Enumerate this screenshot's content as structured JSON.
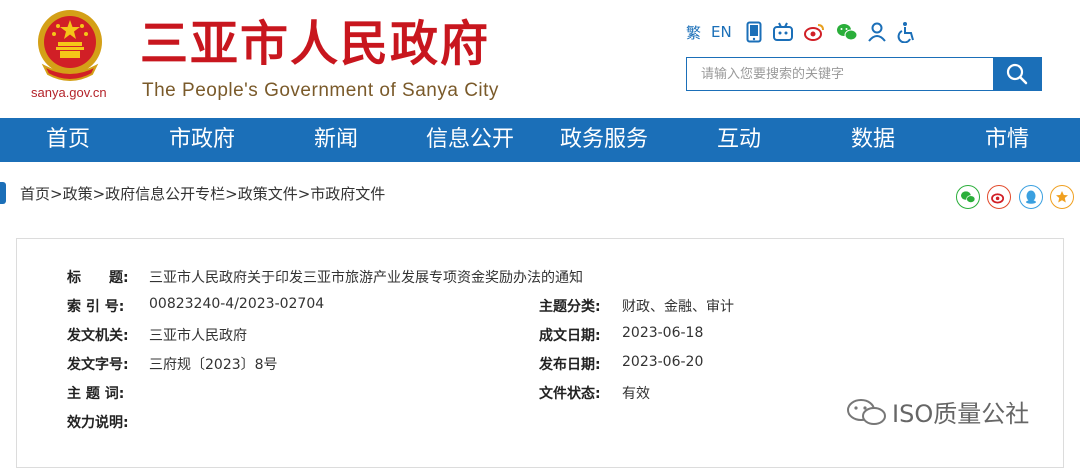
{
  "header": {
    "domain": "sanya.gov.cn",
    "title": "三亚市人民政府",
    "subtitle": "The People's Government of Sanya City",
    "tools": {
      "traditional": "繁",
      "english": "EN"
    },
    "search": {
      "placeholder": "请输入您要搜索的关键字"
    }
  },
  "nav": {
    "items": [
      "首页",
      "市政府",
      "新闻",
      "信息公开",
      "政务服务",
      "互动",
      "数据",
      "市情"
    ]
  },
  "breadcrumb": "首页>政策>政府信息公开专栏>政策文件>市政府文件",
  "document": {
    "labels": {
      "title": "标　　题:",
      "index": "索 引 号:",
      "topic_class": "主题分类:",
      "issuer": "发文机关:",
      "written_date": "成文日期:",
      "doc_number": "发文字号:",
      "publish_date": "发布日期:",
      "keywords": "主 题 词:",
      "status": "文件状态:",
      "validity_note": "效力说明:"
    },
    "values": {
      "title": "三亚市人民政府关于印发三亚市旅游产业发展专项资金奖励办法的通知",
      "index": "00823240-4/2023-02704",
      "topic_class": "财政、金融、审计",
      "issuer": "三亚市人民政府",
      "written_date": "2023-06-18",
      "doc_number": "三府规〔2023〕8号",
      "publish_date": "2023-06-20",
      "keywords": "",
      "status": "有效",
      "validity_note": ""
    }
  },
  "watermark": "ISO质量公社",
  "colors": {
    "brand_red": "#c8161e",
    "nav_blue": "#1b6fb8"
  }
}
